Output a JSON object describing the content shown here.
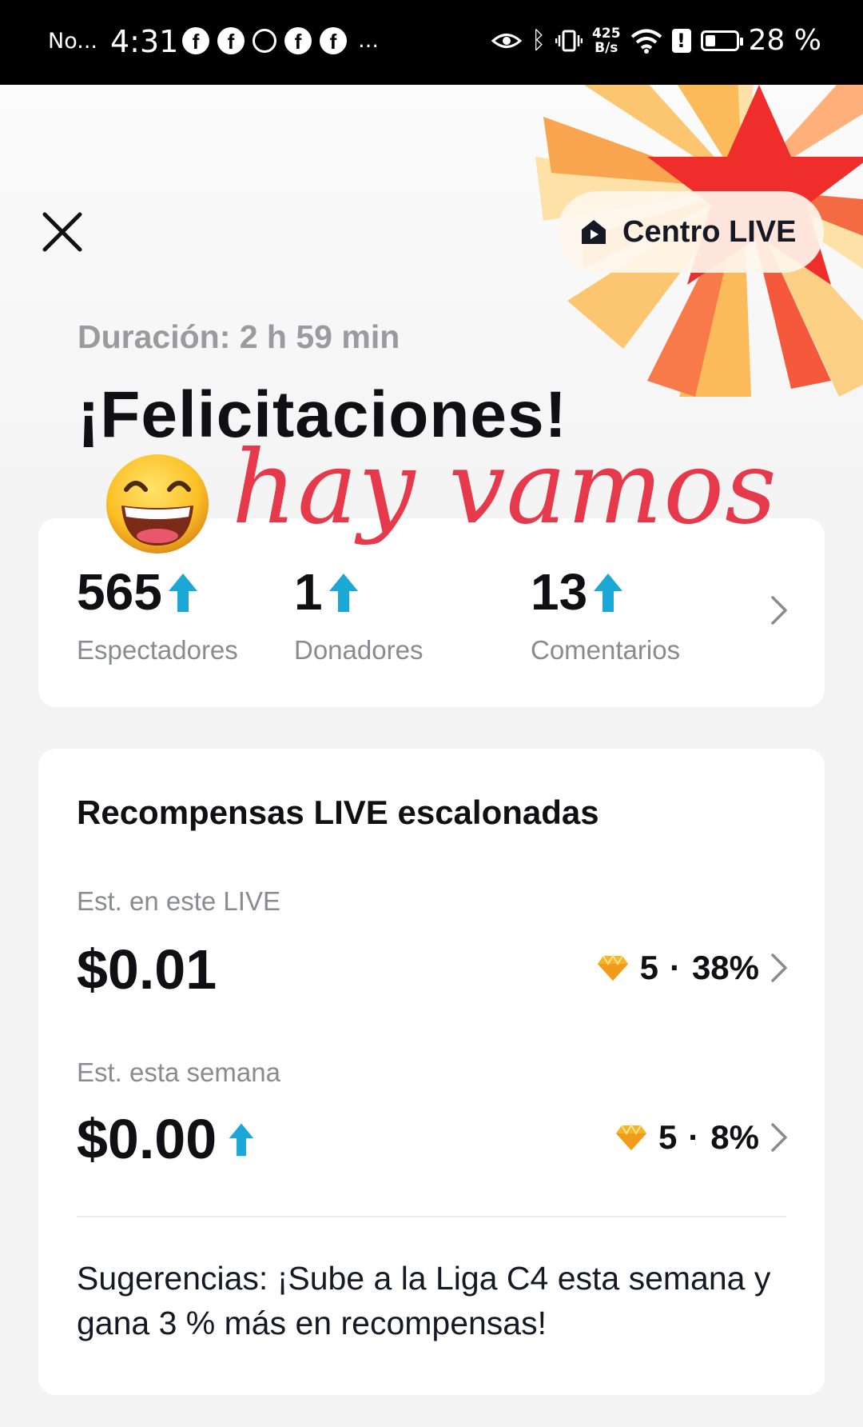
{
  "status_bar": {
    "carrier": "No...",
    "time": "4:31",
    "notification_icons": [
      "facebook-icon",
      "facebook-icon",
      "whatsapp-icon",
      "facebook-icon",
      "facebook-icon"
    ],
    "more": "…",
    "net_speed_value": "425",
    "net_speed_unit": "B/s",
    "battery": "28 %"
  },
  "header": {
    "close_icon": "close-icon",
    "live_center_label": "Centro LIVE",
    "live_center_icon": "live-home-icon"
  },
  "summary": {
    "duration": "Duración: 2 h 59 min",
    "title": "¡Felicitaciones!",
    "handwritten_text": "hay vamos",
    "emoji": "grinning-face-emoji"
  },
  "stats": [
    {
      "value": "565",
      "label": "Espectadores",
      "trend": "up"
    },
    {
      "value": "1",
      "label": "Donadores",
      "trend": "up"
    },
    {
      "value": "13",
      "label": "Comentarios",
      "trend": "up"
    }
  ],
  "rewards": {
    "title": "Recompensas LIVE escalonadas",
    "this_live": {
      "label": "Est. en este LIVE",
      "amount": "$0.01",
      "diamonds": "5",
      "separator": "·",
      "percent": "38%"
    },
    "this_week": {
      "label": "Est. esta semana",
      "amount": "$0.00",
      "trend": "up",
      "diamonds": "5",
      "separator": "·",
      "percent": "8%"
    },
    "suggestion": "Sugerencias: ¡Sube a la Liga C4 esta semana y gana 3 % más en recompensas!"
  },
  "colors": {
    "accent_teal": "#1ba8d6",
    "handwriting_red": "#e6394b",
    "diamond_gold": "#f5b327"
  }
}
